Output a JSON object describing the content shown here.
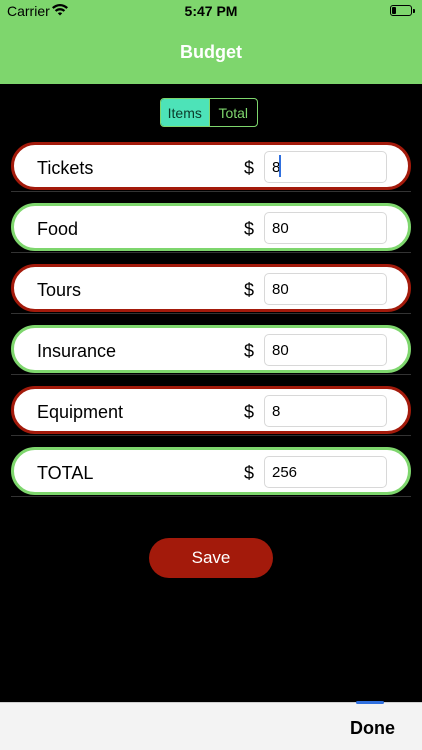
{
  "status_bar": {
    "carrier": "Carrier",
    "time": "5:47 PM"
  },
  "nav": {
    "title": "Budget"
  },
  "segments": [
    {
      "label": "Items",
      "selected": true
    },
    {
      "label": "Total",
      "selected": false
    }
  ],
  "currency_symbol": "$",
  "rows": [
    {
      "label": "Tickets",
      "value": "8",
      "border": "#a31a0b"
    },
    {
      "label": "Food",
      "value": "80",
      "border": "#7ed66d"
    },
    {
      "label": "Tours",
      "value": "80",
      "border": "#a31a0b"
    },
    {
      "label": "Insurance",
      "value": "80",
      "border": "#7ed66d"
    },
    {
      "label": "Equipment",
      "value": "8",
      "border": "#a31a0b"
    },
    {
      "label": "TOTAL",
      "value": "256",
      "border": "#7ed66d"
    }
  ],
  "save_label": "Save",
  "toolbar": {
    "done_label": "Done"
  },
  "colors": {
    "accent_green": "#7ed66d",
    "accent_red": "#a31a0b",
    "segment_active": "#4de3b8"
  }
}
